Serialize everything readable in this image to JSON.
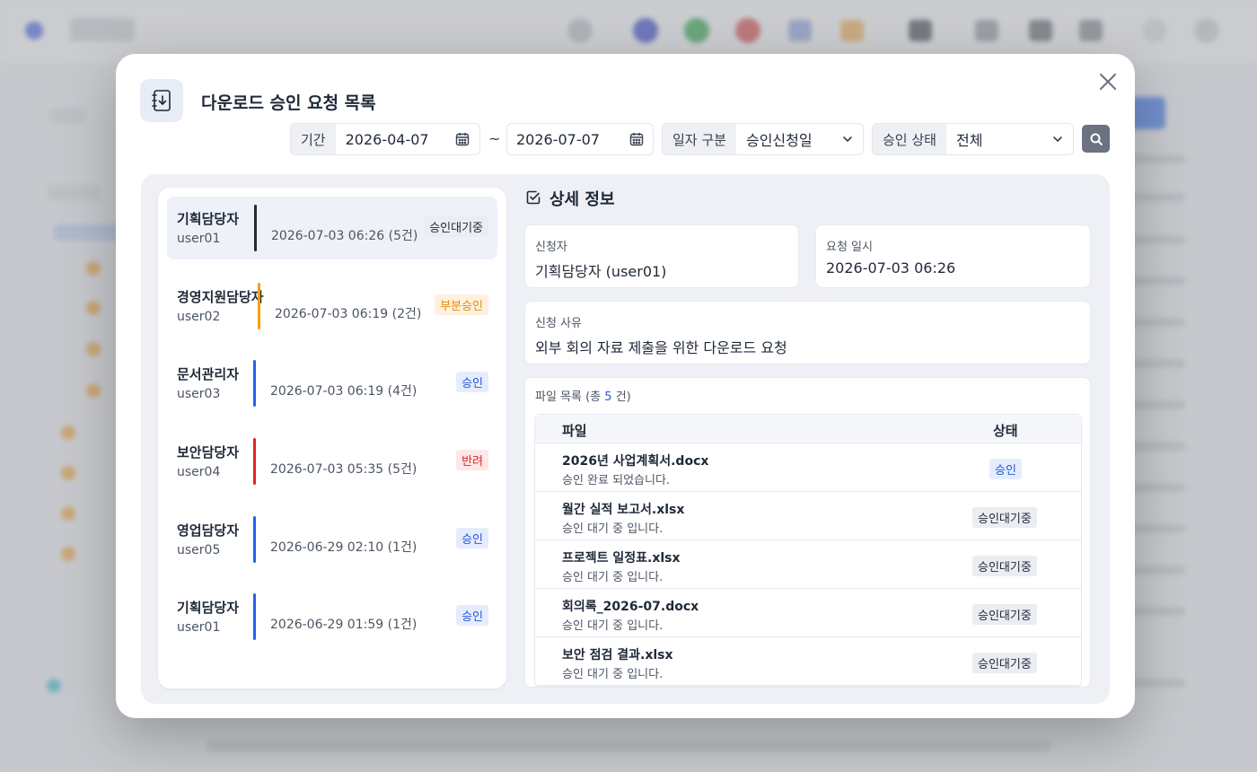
{
  "modal": {
    "title": "다운로드 승인 요청 목록",
    "icon": "download-list-icon"
  },
  "filters": {
    "period_label": "기간",
    "start_date": "2026-04-07",
    "separator": "~",
    "end_date": "2026-07-07",
    "date_type_label": "일자 구분",
    "date_type_value": "승인신청일",
    "status_label": "승인 상태",
    "status_value": "전체"
  },
  "requests": [
    {
      "name": "기획담당자",
      "user": "user01",
      "datetime": "2026-07-03 06:26 (5건)",
      "status": "승인대기중",
      "status_type": "wait",
      "bar_color": "#1f2937",
      "selected": true
    },
    {
      "name": "경영지원담당자",
      "user": "user02",
      "datetime": "2026-07-03 06:19 (2건)",
      "status": "부분승인",
      "status_type": "partial",
      "bar_color": "#f59e0b",
      "selected": false
    },
    {
      "name": "문서관리자",
      "user": "user03",
      "datetime": "2026-07-03 06:19 (4건)",
      "status": "승인",
      "status_type": "ok",
      "bar_color": "#2563eb",
      "selected": false
    },
    {
      "name": "보안담당자",
      "user": "user04",
      "datetime": "2026-07-03 05:35 (5건)",
      "status": "반려",
      "status_type": "reject",
      "bar_color": "#dc2626",
      "selected": false
    },
    {
      "name": "영업담당자",
      "user": "user05",
      "datetime": "2026-06-29 02:10 (1건)",
      "status": "승인",
      "status_type": "ok",
      "bar_color": "#2563eb",
      "selected": false
    },
    {
      "name": "기획담당자",
      "user": "user01",
      "datetime": "2026-06-29 01:59 (1건)",
      "status": "승인",
      "status_type": "ok",
      "bar_color": "#2563eb",
      "selected": false
    }
  ],
  "detail": {
    "title": "상세 정보",
    "applicant_label": "신청자",
    "applicant_value": "기획담당자 (user01)",
    "request_time_label": "요청 일시",
    "request_time_value": "2026-07-03 06:26",
    "reason_label": "신청 사유",
    "reason_value": "외부 회의 자료 제출을 위한 다운로드 요청",
    "files_caption_prefix": "파일 목록 (총 ",
    "files_count": "5",
    "files_caption_suffix": " 건)",
    "col_file": "파일",
    "col_status": "상태",
    "files": [
      {
        "name": "2026년 사업계획서.docx",
        "message": "승인 완료 되었습니다.",
        "status": "승인",
        "status_type": "ok"
      },
      {
        "name": "월간 실적 보고서.xlsx",
        "message": "승인 대기 중 입니다.",
        "status": "승인대기중",
        "status_type": "wait"
      },
      {
        "name": "프로젝트 일정표.xlsx",
        "message": "승인 대기 중 입니다.",
        "status": "승인대기중",
        "status_type": "wait"
      },
      {
        "name": "회의록_2026-07.docx",
        "message": "승인 대기 중 입니다.",
        "status": "승인대기중",
        "status_type": "wait"
      },
      {
        "name": "보안 점검 결과.xlsx",
        "message": "승인 대기 중 입니다.",
        "status": "승인대기중",
        "status_type": "wait"
      }
    ]
  }
}
